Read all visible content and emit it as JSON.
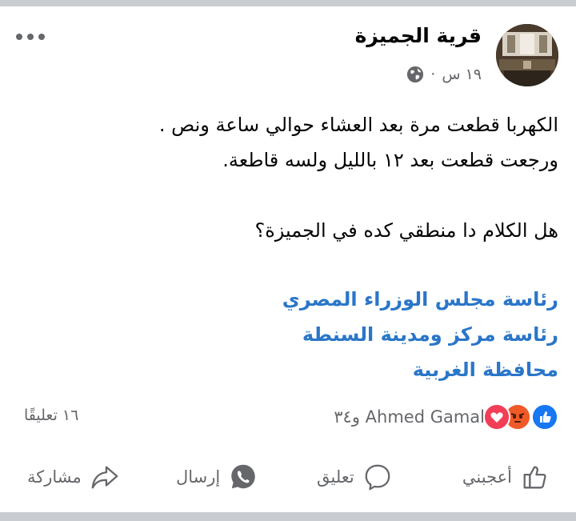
{
  "post": {
    "page_name": "قرية الجميزة",
    "time": "١٩ س",
    "separator": "·",
    "lines": [
      "الكهربا قطعت مرة بعد العشاء حوالي ساعة ونص .",
      "ورجعت قطعت بعد ١٢ بالليل ولسه قاطعة.",
      "هل الكلام دا منطقي كده في الجميزة؟"
    ],
    "tags": [
      "رئاسة مجلس الوزراء المصري",
      "رئاسة مركز ومدينة السنطة",
      "محافظة الغربية"
    ]
  },
  "stats": {
    "reactions_text": "Ahmed Gamal و٣٤",
    "comments": "١٦ تعليقًا"
  },
  "actions": {
    "like": "أعجبني",
    "comment": "تعليق",
    "send": "إرسال",
    "share": "مشاركة"
  },
  "colors": {
    "link": "#2a76c9",
    "like": "#1877f2",
    "angry": "#f05a28",
    "love": "#f33e58",
    "meta": "#65676b"
  }
}
